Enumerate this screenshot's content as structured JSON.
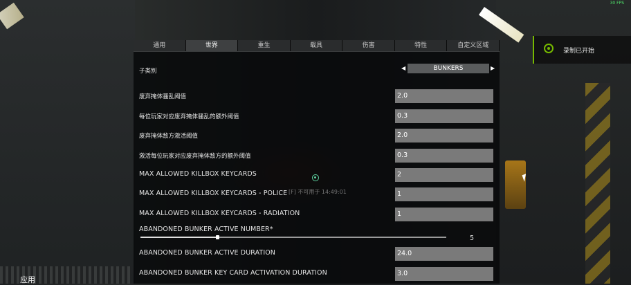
{
  "hud": {
    "fps": "30 FPS",
    "apply_label": "应用",
    "ghost_text": "[F] 不可用于 14:49:01"
  },
  "notification": {
    "text": "录制已开始",
    "icon": "record-icon",
    "accent": "#76b900"
  },
  "tabs": [
    {
      "label": "通用",
      "active": false
    },
    {
      "label": "世界",
      "active": true
    },
    {
      "label": "重生",
      "active": false
    },
    {
      "label": "载具",
      "active": false
    },
    {
      "label": "伤害",
      "active": false
    },
    {
      "label": "特性",
      "active": false
    },
    {
      "label": "自定义区域",
      "active": false
    }
  ],
  "subcategory": {
    "label": "子类别",
    "value": "BUNKERS",
    "prev_icon": "left-arrow-icon",
    "next_icon": "right-arrow-icon"
  },
  "settings": [
    {
      "label": "废弃掩体骚乱阈值",
      "value": "2.0"
    },
    {
      "label": "每位玩家对应废弃掩体骚乱的额外阈值",
      "value": "0.3"
    },
    {
      "label": "废弃掩体敌方激活阈值",
      "value": "2.0"
    },
    {
      "label": "激活每位玩家对应废弃掩体敌方的额外阈值",
      "value": "0.3"
    },
    {
      "label": "MAX ALLOWED KILLBOX KEYCARDS",
      "value": "2"
    },
    {
      "label": "MAX ALLOWED KILLBOX KEYCARDS - POLICE",
      "value": "1"
    },
    {
      "label": "MAX ALLOWED KILLBOX KEYCARDS - RADIATION",
      "value": "1"
    }
  ],
  "slider": {
    "label": "ABANDONED BUNKER ACTIVE NUMBER*",
    "value": "5",
    "fraction": 0.25
  },
  "settings2": [
    {
      "label": "ABANDONED BUNKER ACTIVE DURATION",
      "value": "24.0"
    },
    {
      "label": "ABANDONED BUNKER KEY CARD ACTIVATION DURATION",
      "value": "3.0"
    }
  ]
}
